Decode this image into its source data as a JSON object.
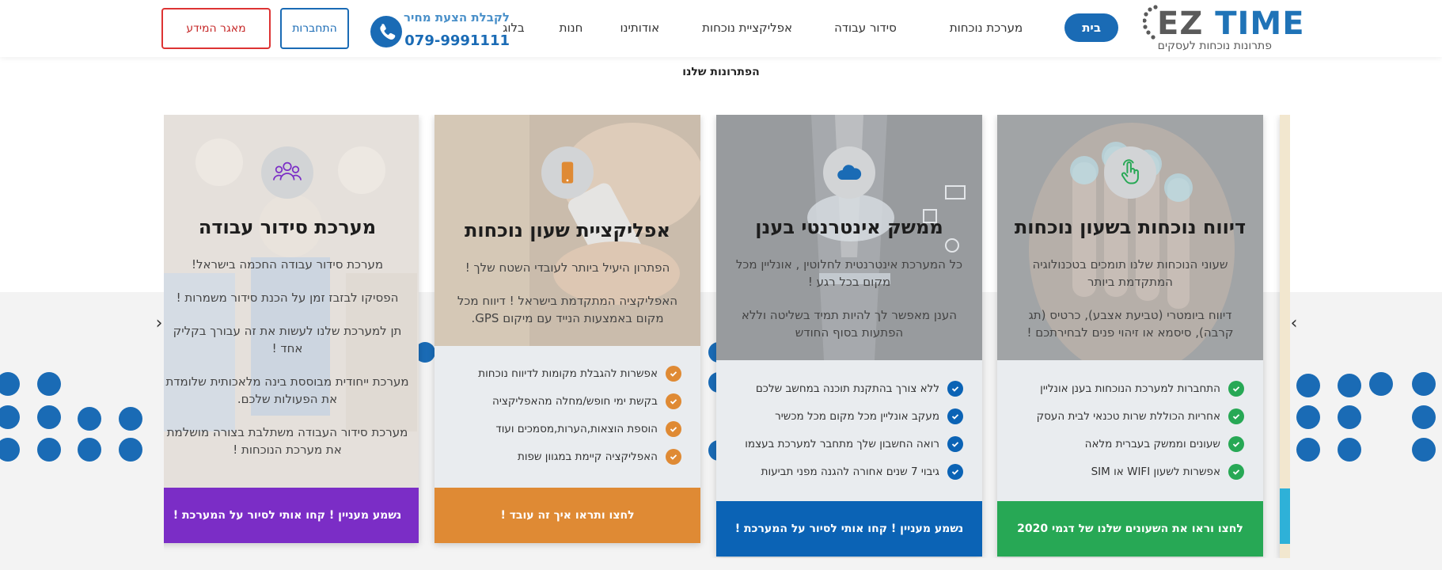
{
  "header": {
    "logo": {
      "brand_ez": "EZ",
      "brand_time": "TIME",
      "tagline": "פתרונות נוכחות לעסקים"
    },
    "nav": [
      {
        "label": "בית",
        "active": true
      },
      {
        "label": "מערכת נוכחות"
      },
      {
        "label": "סידור עבודה"
      },
      {
        "label": "אפליקציית נוכחות"
      },
      {
        "label": "אודותינו"
      },
      {
        "label": "חנות"
      },
      {
        "label": "בלוג"
      }
    ],
    "phone": {
      "label": "לקבלת הצעת מחיר",
      "number": "079-9991111"
    },
    "login_label": "התחברות",
    "database_label": "מאגר המידע"
  },
  "section": {
    "title": "הפתרונות שלנו"
  },
  "colors": {
    "primary": "#1a6bb5",
    "green": "#27a855",
    "blue": "#0b63b5",
    "orange": "#df8a34",
    "purple": "#7b2dc6",
    "red": "#c62828"
  },
  "cards": [
    {
      "icon": "fingerprint-touch-icon",
      "title": "דיווח נוכחות בשעון נוכחות",
      "desc": [
        "שעוני הנוכחות שלנו תומכים בטכנולוגיה המתקדמת ביותר",
        "דיווח ביומטרי (טביעת אצבע), כרטיס (תג קרבה), סיסמא או זיהוי פנים לבחירתכם !"
      ],
      "features": [
        "התחברות למערכת הנוכחות בענן אונליין",
        "אחריות הכוללת שרות טכנאי לבית העסק",
        "שעונים וממשק בעברית מלאה",
        "אפשרות לשעון WIFI או SIM"
      ],
      "cta": "לחצו וראו את השעונים שלנו של דגמי 2020",
      "accent": "#27a855"
    },
    {
      "icon": "cloud-icon",
      "title": "ממשק אינטרנטי בענן",
      "desc": [
        "כל המערכת אינטרנטית לחלוטין , אונליין מכל מקום בכל רגע !",
        "הענן מאפשר לך להיות תמיד בשליטה וללא הפתעות בסוף החודש"
      ],
      "features": [
        "ללא צורך בהתקנת תוכנה במחשב שלכם",
        "מעקב אונליין מכל מקום מכל מכשיר",
        "רואה החשבון שלך מתחבר למערכת בעצמו",
        "גיבוי 7 שנים אחורה להגנה מפני תביעות"
      ],
      "cta": "נשמע מעניין ! קחו אותי לסיור על המערכת !",
      "accent": "#0b63b5"
    },
    {
      "icon": "smartphone-icon",
      "title": "אפליקציית שעון נוכחות",
      "desc": [
        "הפתרון היעיל ביותר לעובדי השטח שלך !",
        "האפליקציה המתקדמת בישראל ! דיווח מכל מקום באמצעות הנייד עם מיקום GPS."
      ],
      "features": [
        "אפשרות להגבלת מקומות לדיווח נוכחות",
        "בקשת ימי חופש/מחלה מהאפליקציה",
        "הוספת הוצאות,הערות,מסמכים ועוד",
        "האפליקציה קיימת במגוון שפות"
      ],
      "cta": "לחצו ותראו איך זה עובד !",
      "accent": "#df8a34"
    },
    {
      "icon": "team-icon",
      "title": "מערכת סידור עבודה",
      "desc": [
        "מערכת סידור עבודה החכמה בישראל!",
        "הפסיקו לבזבז זמן על הכנת סידור משמרות !",
        "תן למערכת שלנו לעשות את זה עבורך בקליק אחד !",
        "מערכת ייחודית מבוססת בינה מלאכותית שלומדת את הפעולות שלכם.",
        "מערכת סידור העבודה משתלבת בצורה מושלמת את מערכת הנוכחות !"
      ],
      "features": [],
      "cta": "נשמע מעניין ! קחו אותי לסיור על המערכת !",
      "accent": "#7b2dc6"
    }
  ]
}
